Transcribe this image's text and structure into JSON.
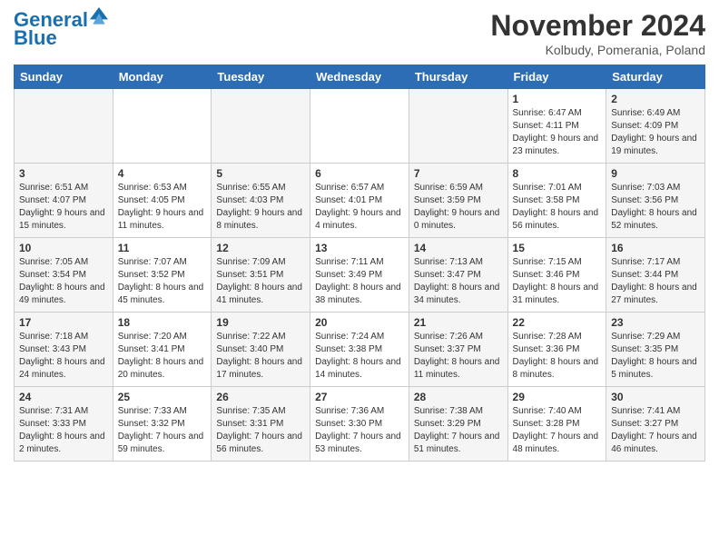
{
  "logo": {
    "line1": "General",
    "line2": "Blue"
  },
  "title": "November 2024",
  "location": "Kolbudy, Pomerania, Poland",
  "days_of_week": [
    "Sunday",
    "Monday",
    "Tuesday",
    "Wednesday",
    "Thursday",
    "Friday",
    "Saturday"
  ],
  "weeks": [
    [
      {
        "day": "",
        "info": ""
      },
      {
        "day": "",
        "info": ""
      },
      {
        "day": "",
        "info": ""
      },
      {
        "day": "",
        "info": ""
      },
      {
        "day": "",
        "info": ""
      },
      {
        "day": "1",
        "info": "Sunrise: 6:47 AM\nSunset: 4:11 PM\nDaylight: 9 hours\nand 23 minutes."
      },
      {
        "day": "2",
        "info": "Sunrise: 6:49 AM\nSunset: 4:09 PM\nDaylight: 9 hours\nand 19 minutes."
      }
    ],
    [
      {
        "day": "3",
        "info": "Sunrise: 6:51 AM\nSunset: 4:07 PM\nDaylight: 9 hours\nand 15 minutes."
      },
      {
        "day": "4",
        "info": "Sunrise: 6:53 AM\nSunset: 4:05 PM\nDaylight: 9 hours\nand 11 minutes."
      },
      {
        "day": "5",
        "info": "Sunrise: 6:55 AM\nSunset: 4:03 PM\nDaylight: 9 hours\nand 8 minutes."
      },
      {
        "day": "6",
        "info": "Sunrise: 6:57 AM\nSunset: 4:01 PM\nDaylight: 9 hours\nand 4 minutes."
      },
      {
        "day": "7",
        "info": "Sunrise: 6:59 AM\nSunset: 3:59 PM\nDaylight: 9 hours\nand 0 minutes."
      },
      {
        "day": "8",
        "info": "Sunrise: 7:01 AM\nSunset: 3:58 PM\nDaylight: 8 hours\nand 56 minutes."
      },
      {
        "day": "9",
        "info": "Sunrise: 7:03 AM\nSunset: 3:56 PM\nDaylight: 8 hours\nand 52 minutes."
      }
    ],
    [
      {
        "day": "10",
        "info": "Sunrise: 7:05 AM\nSunset: 3:54 PM\nDaylight: 8 hours\nand 49 minutes."
      },
      {
        "day": "11",
        "info": "Sunrise: 7:07 AM\nSunset: 3:52 PM\nDaylight: 8 hours\nand 45 minutes."
      },
      {
        "day": "12",
        "info": "Sunrise: 7:09 AM\nSunset: 3:51 PM\nDaylight: 8 hours\nand 41 minutes."
      },
      {
        "day": "13",
        "info": "Sunrise: 7:11 AM\nSunset: 3:49 PM\nDaylight: 8 hours\nand 38 minutes."
      },
      {
        "day": "14",
        "info": "Sunrise: 7:13 AM\nSunset: 3:47 PM\nDaylight: 8 hours\nand 34 minutes."
      },
      {
        "day": "15",
        "info": "Sunrise: 7:15 AM\nSunset: 3:46 PM\nDaylight: 8 hours\nand 31 minutes."
      },
      {
        "day": "16",
        "info": "Sunrise: 7:17 AM\nSunset: 3:44 PM\nDaylight: 8 hours\nand 27 minutes."
      }
    ],
    [
      {
        "day": "17",
        "info": "Sunrise: 7:18 AM\nSunset: 3:43 PM\nDaylight: 8 hours\nand 24 minutes."
      },
      {
        "day": "18",
        "info": "Sunrise: 7:20 AM\nSunset: 3:41 PM\nDaylight: 8 hours\nand 20 minutes."
      },
      {
        "day": "19",
        "info": "Sunrise: 7:22 AM\nSunset: 3:40 PM\nDaylight: 8 hours\nand 17 minutes."
      },
      {
        "day": "20",
        "info": "Sunrise: 7:24 AM\nSunset: 3:38 PM\nDaylight: 8 hours\nand 14 minutes."
      },
      {
        "day": "21",
        "info": "Sunrise: 7:26 AM\nSunset: 3:37 PM\nDaylight: 8 hours\nand 11 minutes."
      },
      {
        "day": "22",
        "info": "Sunrise: 7:28 AM\nSunset: 3:36 PM\nDaylight: 8 hours\nand 8 minutes."
      },
      {
        "day": "23",
        "info": "Sunrise: 7:29 AM\nSunset: 3:35 PM\nDaylight: 8 hours\nand 5 minutes."
      }
    ],
    [
      {
        "day": "24",
        "info": "Sunrise: 7:31 AM\nSunset: 3:33 PM\nDaylight: 8 hours\nand 2 minutes."
      },
      {
        "day": "25",
        "info": "Sunrise: 7:33 AM\nSunset: 3:32 PM\nDaylight: 7 hours\nand 59 minutes."
      },
      {
        "day": "26",
        "info": "Sunrise: 7:35 AM\nSunset: 3:31 PM\nDaylight: 7 hours\nand 56 minutes."
      },
      {
        "day": "27",
        "info": "Sunrise: 7:36 AM\nSunset: 3:30 PM\nDaylight: 7 hours\nand 53 minutes."
      },
      {
        "day": "28",
        "info": "Sunrise: 7:38 AM\nSunset: 3:29 PM\nDaylight: 7 hours\nand 51 minutes."
      },
      {
        "day": "29",
        "info": "Sunrise: 7:40 AM\nSunset: 3:28 PM\nDaylight: 7 hours\nand 48 minutes."
      },
      {
        "day": "30",
        "info": "Sunrise: 7:41 AM\nSunset: 3:27 PM\nDaylight: 7 hours\nand 46 minutes."
      }
    ]
  ]
}
